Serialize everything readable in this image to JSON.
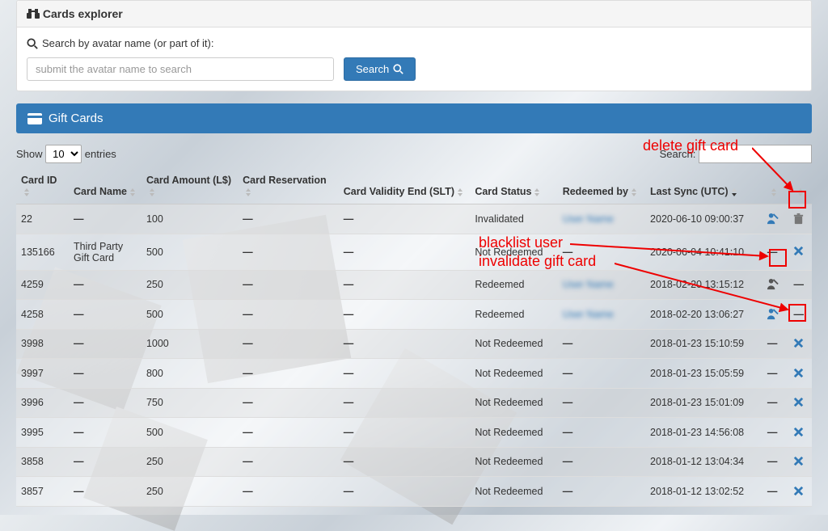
{
  "explorer": {
    "title": "Cards explorer",
    "search_label": "Search by avatar name (or part of it):",
    "placeholder": "submit the avatar name to search",
    "search_button": "Search"
  },
  "section_title": "Gift Cards",
  "datatable": {
    "show_prefix": "Show",
    "show_value": "10",
    "show_suffix": "entries",
    "search_label": "Search:",
    "columns": {
      "id": "Card ID",
      "name": "Card Name",
      "amount": "Card Amount (L$)",
      "reservation": "Card Reservation",
      "validity": "Card Validity End (SLT)",
      "status": "Card Status",
      "redeemed": "Redeemed by",
      "sync": "Last Sync (UTC)"
    }
  },
  "rows": [
    {
      "id": "22",
      "name": "—",
      "amount": "100",
      "reserv": "—",
      "validity": "—",
      "status": "Invalidated",
      "redeemed": "blur",
      "sync": "2020-06-10 09:00:37",
      "a1": "blacklist",
      "a2": "trash"
    },
    {
      "id": "135166",
      "name": "Third Party Gift Card",
      "amount": "500",
      "reserv": "—",
      "validity": "—",
      "status": "Not Redeemed",
      "redeemed": "—",
      "sync": "2020-06-04 10:41:10",
      "a1": "—",
      "a2": "x"
    },
    {
      "id": "4259",
      "name": "—",
      "amount": "250",
      "reserv": "—",
      "validity": "—",
      "status": "Redeemed",
      "redeemed": "blur",
      "sync": "2018-02-20 13:15:12",
      "a1": "blacklist-dark",
      "a2": "—"
    },
    {
      "id": "4258",
      "name": "—",
      "amount": "500",
      "reserv": "—",
      "validity": "—",
      "status": "Redeemed",
      "redeemed": "blur",
      "sync": "2018-02-20 13:06:27",
      "a1": "blacklist",
      "a2": "—"
    },
    {
      "id": "3998",
      "name": "—",
      "amount": "1000",
      "reserv": "—",
      "validity": "—",
      "status": "Not Redeemed",
      "redeemed": "—",
      "sync": "2018-01-23 15:10:59",
      "a1": "—",
      "a2": "x"
    },
    {
      "id": "3997",
      "name": "—",
      "amount": "800",
      "reserv": "—",
      "validity": "—",
      "status": "Not Redeemed",
      "redeemed": "—",
      "sync": "2018-01-23 15:05:59",
      "a1": "—",
      "a2": "x"
    },
    {
      "id": "3996",
      "name": "—",
      "amount": "750",
      "reserv": "—",
      "validity": "—",
      "status": "Not Redeemed",
      "redeemed": "—",
      "sync": "2018-01-23 15:01:09",
      "a1": "—",
      "a2": "x"
    },
    {
      "id": "3995",
      "name": "—",
      "amount": "500",
      "reserv": "—",
      "validity": "—",
      "status": "Not Redeemed",
      "redeemed": "—",
      "sync": "2018-01-23 14:56:08",
      "a1": "—",
      "a2": "x"
    },
    {
      "id": "3858",
      "name": "—",
      "amount": "250",
      "reserv": "—",
      "validity": "—",
      "status": "Not Redeemed",
      "redeemed": "—",
      "sync": "2018-01-12 13:04:34",
      "a1": "—",
      "a2": "x"
    },
    {
      "id": "3857",
      "name": "—",
      "amount": "250",
      "reserv": "—",
      "validity": "—",
      "status": "Not Redeemed",
      "redeemed": "—",
      "sync": "2018-01-12 13:02:52",
      "a1": "—",
      "a2": "x"
    }
  ],
  "annotations": {
    "delete": "delete gift card",
    "blacklist": "blacklist user",
    "invalidate": "invalidate gift card"
  }
}
